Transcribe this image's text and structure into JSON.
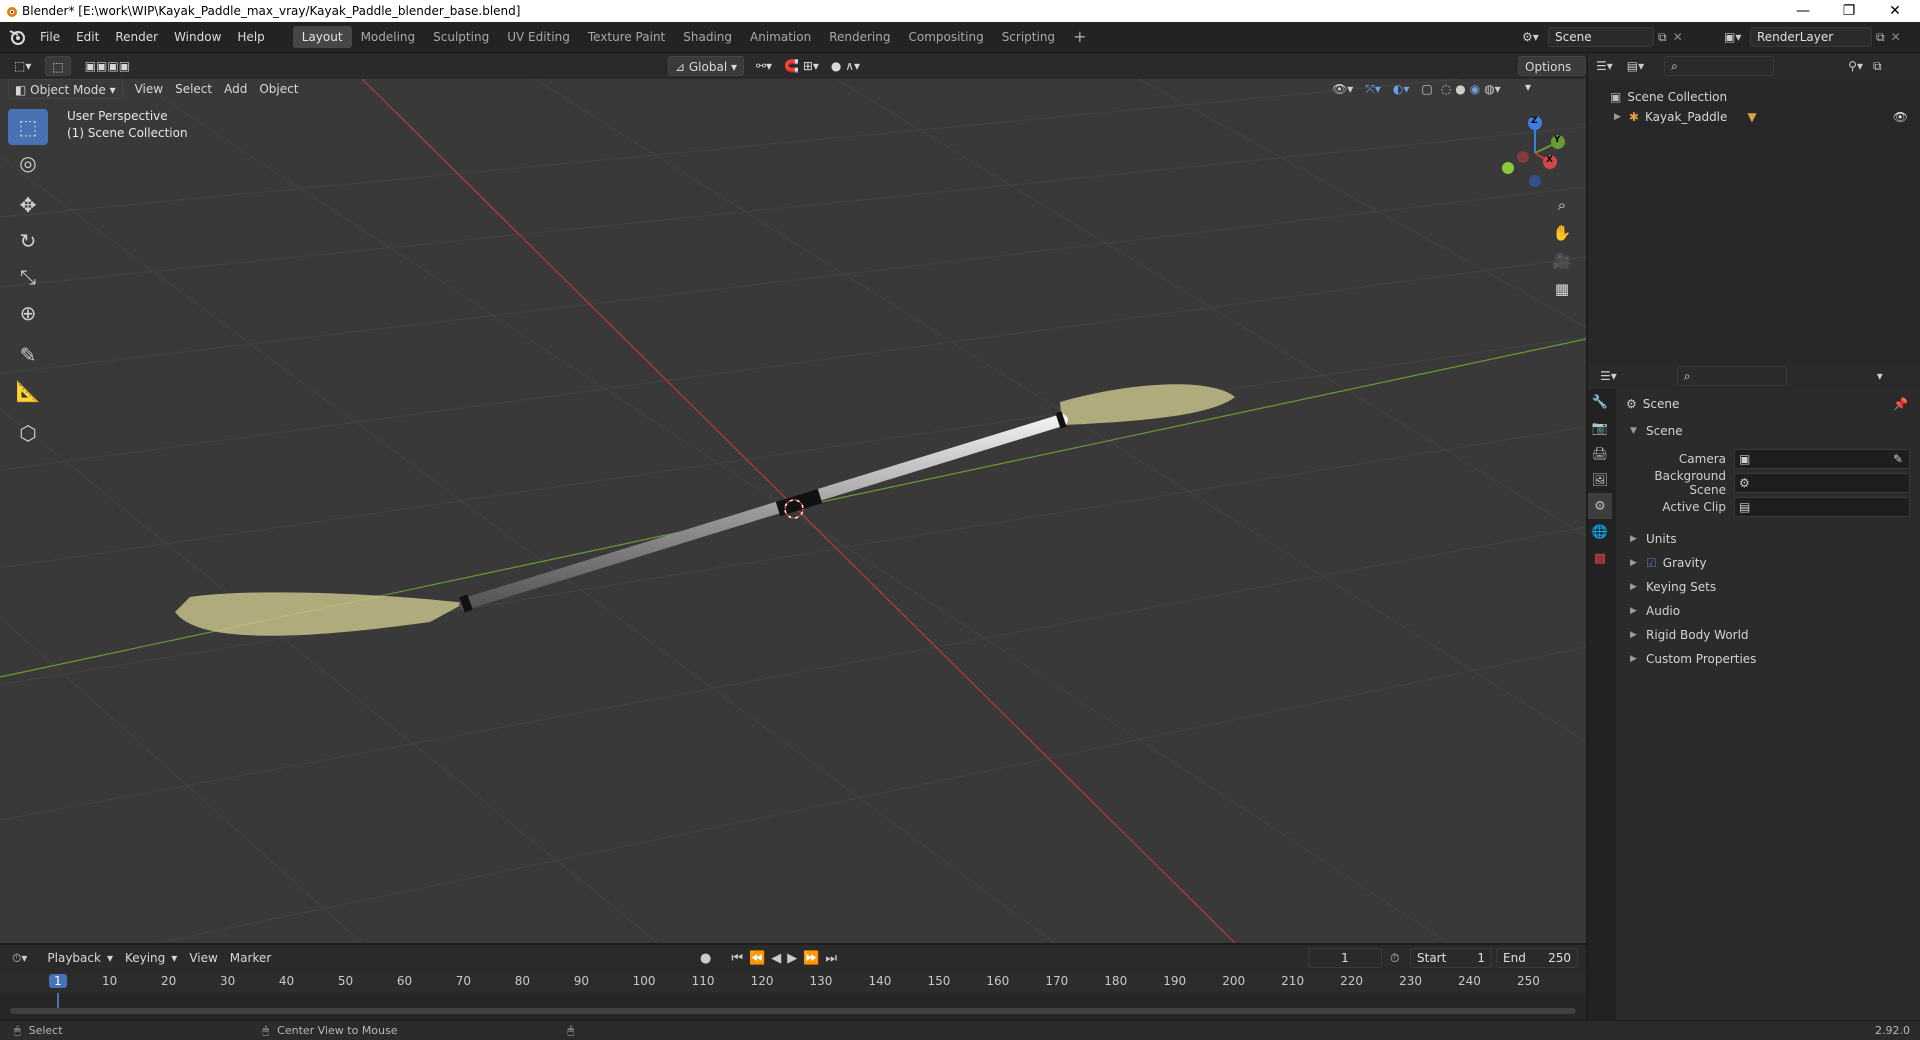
{
  "window": {
    "title": "Blender* [E:\\work\\WIP\\Kayak_Paddle_max_vray/Kayak_Paddle_blender_base.blend]",
    "minimize": "—",
    "maximize": "❐",
    "close": "✕"
  },
  "menu": [
    "File",
    "Edit",
    "Render",
    "Window",
    "Help"
  ],
  "workspaces": [
    "Layout",
    "Modeling",
    "Sculpting",
    "UV Editing",
    "Texture Paint",
    "Shading",
    "Animation",
    "Rendering",
    "Compositing",
    "Scripting"
  ],
  "active_workspace": "Layout",
  "add_workspace": "+",
  "scene_selector": "Scene",
  "renderlayer_selector": "RenderLayer",
  "viewport": {
    "orientation": "Global",
    "options": "Options",
    "mode": "Object Mode",
    "menus": [
      "View",
      "Select",
      "Add",
      "Object"
    ],
    "overlay_line1": "User Perspective",
    "overlay_line2": "(1) Scene Collection",
    "gizmo": {
      "x": "X",
      "y": "Y",
      "z": "Z"
    }
  },
  "outliner": {
    "root": "Scene Collection",
    "items": [
      "Kayak_Paddle"
    ]
  },
  "properties": {
    "context": "Scene",
    "panel": "Scene",
    "fields": [
      {
        "label": "Camera",
        "value": ""
      },
      {
        "label": "Background Scene",
        "value": ""
      },
      {
        "label": "Active Clip",
        "value": ""
      }
    ],
    "subpanels": [
      "Units",
      "Gravity",
      "Keying Sets",
      "Audio",
      "Rigid Body World",
      "Custom Properties"
    ],
    "gravity_checked": true
  },
  "timeline": {
    "menus": [
      "Playback",
      "Keying",
      "View",
      "Marker"
    ],
    "current_frame": "1",
    "start_label": "Start",
    "start": "1",
    "end_label": "End",
    "end": "250",
    "ticks": [
      "1",
      "10",
      "20",
      "30",
      "40",
      "50",
      "60",
      "70",
      "80",
      "90",
      "100",
      "110",
      "120",
      "130",
      "140",
      "150",
      "160",
      "170",
      "180",
      "190",
      "200",
      "210",
      "220",
      "230",
      "240",
      "250"
    ]
  },
  "status": {
    "left": "Select",
    "middle": "Center View to Mouse",
    "version": "2.92.0"
  },
  "colors": {
    "accent": "#4772b3",
    "x_axis": "#b83a3a",
    "y_axis": "#6a9a34",
    "z_axis": "#3d7fe0",
    "paddle_blade": "#c6c08a",
    "viewport_bg": "#393939"
  }
}
